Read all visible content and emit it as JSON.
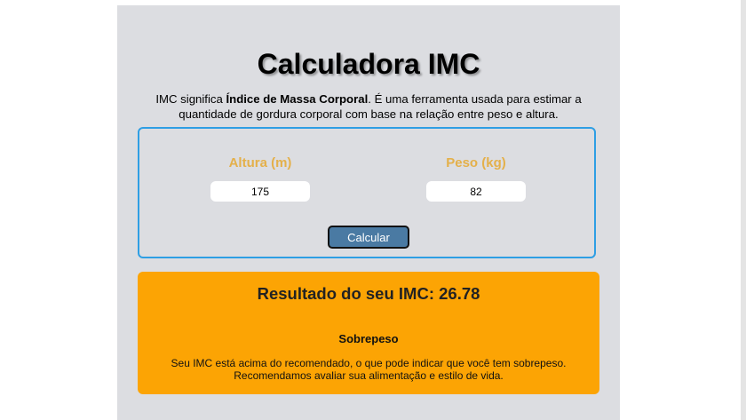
{
  "page": {
    "title": "Calculadora IMC",
    "intro": {
      "prefix": "IMC significa ",
      "term": "Índice de Massa Corporal",
      "suffix": ". É uma ferramenta usada para estimar a quantidade de gordura corporal com base na relação entre peso e altura."
    }
  },
  "form": {
    "altura": {
      "label": "Altura (m)",
      "value": "175"
    },
    "peso": {
      "label": "Peso (kg)",
      "value": "82"
    },
    "button_label": "Calcular"
  },
  "result": {
    "title": "Resultado do seu IMC: 26.78",
    "category": "Sobrepeso",
    "description": "Seu IMC está acima do recomendado, o que pode indicar que você tem sobrepeso. Recomendamos avaliar sua alimentação e estilo de vida."
  },
  "colors": {
    "panel_bg": "#dcdde1",
    "form_border": "#2f9fe4",
    "label_color": "#e4b04a",
    "button_bg": "#4a7aa3",
    "result_bg": "#fca404"
  }
}
